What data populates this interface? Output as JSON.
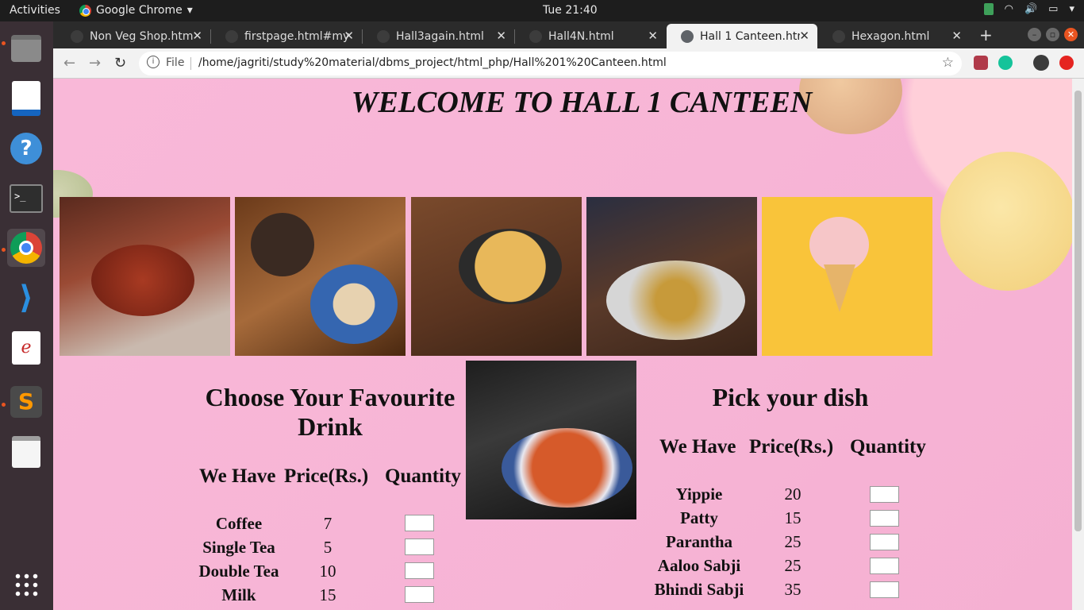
{
  "system": {
    "activities": "Activities",
    "app_name": "Google Chrome",
    "clock": "Tue 21:40"
  },
  "browser": {
    "tabs": [
      {
        "title": "Non Veg Shop.htm",
        "active": false
      },
      {
        "title": "firstpage.html#my",
        "active": false
      },
      {
        "title": "Hall3again.html",
        "active": false
      },
      {
        "title": "Hall4N.html",
        "active": false
      },
      {
        "title": "Hall 1 Canteen.htm",
        "active": true
      },
      {
        "title": "Hexagon.html",
        "active": false
      }
    ],
    "address": {
      "scheme": "File",
      "url": "/home/jagriti/study%20material/dbms_project/html_php/Hall%201%20Canteen.html"
    }
  },
  "page": {
    "title": "WELCOME TO HALL 1 CANTEEN",
    "drinks": {
      "heading_line1": "Choose Your Favourite",
      "heading_line2": "Drink",
      "col_item": "We Have",
      "col_price": "Price(Rs.)",
      "col_qty": "Quantity",
      "items": [
        {
          "name": "Coffee",
          "price": "7"
        },
        {
          "name": "Single Tea",
          "price": "5"
        },
        {
          "name": "Double Tea",
          "price": "10"
        },
        {
          "name": "Milk",
          "price": "15"
        }
      ]
    },
    "dishes": {
      "heading": "Pick your dish",
      "col_item": "We Have",
      "col_price": "Price(Rs.)",
      "col_qty": "Quantity",
      "items": [
        {
          "name": "Yippie",
          "price": "20"
        },
        {
          "name": "Patty",
          "price": "15"
        },
        {
          "name": "Parantha",
          "price": "25"
        },
        {
          "name": "Aaloo Sabji",
          "price": "25"
        },
        {
          "name": "Bhindi Sabji",
          "price": "35"
        }
      ]
    }
  }
}
